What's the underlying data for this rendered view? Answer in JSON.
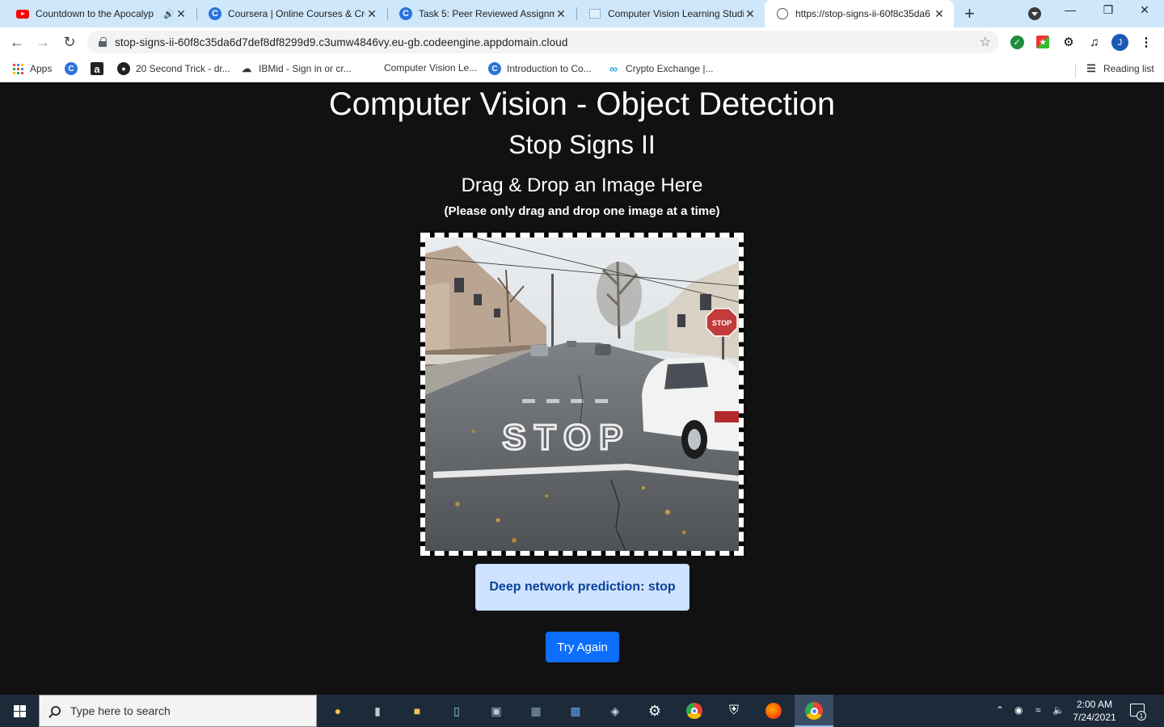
{
  "browser": {
    "tabs": [
      {
        "title": "Countdown to the Apocalyp",
        "icon": "youtube-icon",
        "audio": true,
        "active": false
      },
      {
        "title": "Coursera | Online Courses & Cre",
        "icon": "coursera-icon",
        "active": false
      },
      {
        "title": "Task 5: Peer Reviewed Assignme",
        "icon": "coursera-icon",
        "active": false
      },
      {
        "title": "Computer Vision Learning Studi",
        "icon": "document-icon",
        "active": false
      },
      {
        "title": "https://stop-signs-ii-60f8c35da6",
        "icon": "globe-icon",
        "active": true
      }
    ],
    "url": "stop-signs-ii-60f8c35da6d7def8df8299d9.c3umw4846vy.eu-gb.codeengine.appdomain.cloud",
    "profile_initial": "J",
    "bookmarks": [
      {
        "label": "Apps",
        "icon": "apps-grid-icon"
      },
      {
        "label": "",
        "icon": "coursera-icon"
      },
      {
        "label": "",
        "icon": "amazon-icon"
      },
      {
        "label": "20 Second Trick - dr...",
        "icon": "dark-circle-icon"
      },
      {
        "label": "IBMid - Sign in or cr...",
        "icon": "ibm-icon"
      },
      {
        "label": "Computer Vision Le...",
        "icon": "none"
      },
      {
        "label": "Introduction to Co...",
        "icon": "coursera-icon"
      },
      {
        "label": "Crypto Exchange |...",
        "icon": "link-icon"
      }
    ],
    "reading_list": "Reading list"
  },
  "page": {
    "title": "Computer Vision - Object Detection",
    "subtitle": "Stop Signs II",
    "drop_heading": "Drag & Drop an Image Here",
    "drop_note": "(Please only drag and drop one image at a time)",
    "prediction": "Deep network prediction: stop",
    "try_again": "Try Again"
  },
  "taskbar": {
    "search_placeholder": "Type here to search",
    "time": "2:00 AM",
    "date": "7/24/2021",
    "notification_count": "1"
  },
  "colors": {
    "page_bg": "#111111",
    "alert_bg": "#cfe2ff",
    "alert_text": "#084298",
    "button_bg": "#0d6efd",
    "tabstrip_bg": "#cfe7fb"
  }
}
